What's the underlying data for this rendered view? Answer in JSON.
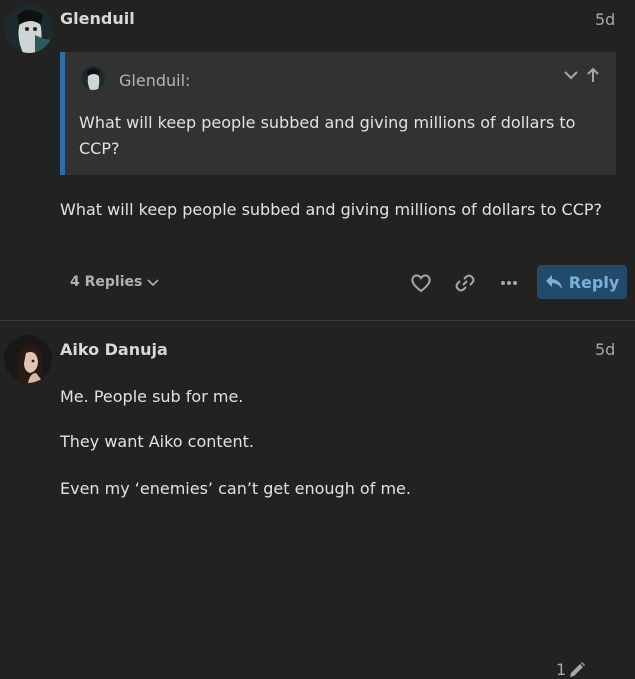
{
  "post1": {
    "username": "Glenduil",
    "date": "5d",
    "quote": {
      "author": "Glenduil:",
      "text": "What will keep people subbed and giving millions of dollars to CCP?"
    },
    "body": "What will keep people subbed and giving millions of dollars to CCP?",
    "replies_label": "4 Replies",
    "reply_button": "Reply"
  },
  "post2": {
    "username": "Aiko Danuja",
    "edit_count": "1",
    "date": "5d",
    "paragraphs": [
      "Me. People sub for me.",
      "They want Aiko content.",
      "Even my ‘enemies’ can’t get enough of me."
    ]
  },
  "colors": {
    "background": "#222222",
    "quote_background": "#323232",
    "quote_border": "#2f6ea5",
    "reply_button_bg": "#234a6a",
    "reply_button_text": "#7ab1da"
  },
  "icons": [
    "chevron-down-icon",
    "arrow-up-icon",
    "heart-icon",
    "link-icon",
    "more-icon",
    "reply-arrow-icon",
    "pencil-icon"
  ]
}
